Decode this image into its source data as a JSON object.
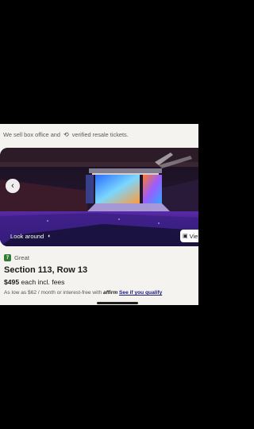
{
  "banner": {
    "text_before": "We sell box office and",
    "refresh_icon": "refresh-icon",
    "text_after": "verified resale tickets."
  },
  "venue_view": {
    "look_around_label": "Look around",
    "look_around_icon": "360-icon",
    "view_button_label": "Vie",
    "view_icon": "image-icon",
    "back_icon": "chevron-left-icon"
  },
  "listing": {
    "deal_badge": "7",
    "deal_label": "Great",
    "section_title": "Section 113, Row 13",
    "price": "$495",
    "price_suffix": "each incl. fees",
    "financing_text": "As low as $62 / month or interest-free with",
    "financing_logo": "affirm",
    "financing_link": "See if you qualify"
  },
  "colors": {
    "deal_green": "#2e7d32",
    "link": "#1a1a7a",
    "page_bg": "#f4f3f0"
  }
}
